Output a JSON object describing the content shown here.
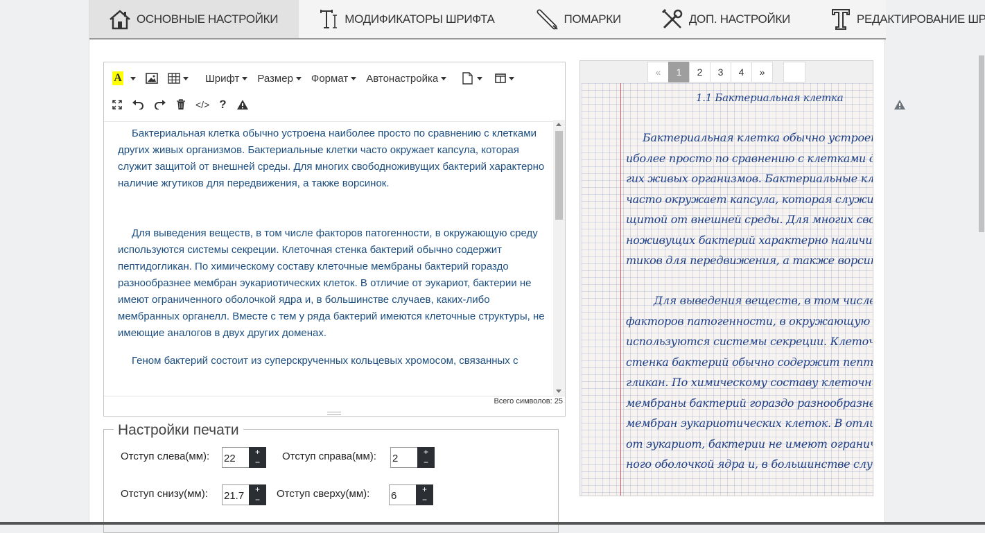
{
  "tabs": [
    {
      "label": "ОСНОВНЫЕ НАСТРОЙКИ",
      "icon": "house-icon",
      "active": true
    },
    {
      "label": "МОДИФИКАТОРЫ ШРИФТА",
      "icon": "text-cursor-icon"
    },
    {
      "label": "ПОМАРКИ",
      "icon": "pen-icon"
    },
    {
      "label": "ДОП. НАСТРОЙКИ",
      "icon": "tools-icon"
    },
    {
      "label": "РЕДАКТИРОВАНИЕ ШРИФТОВ",
      "icon": "font-t-icon"
    }
  ],
  "toolbar": {
    "font_label": "Шрифт",
    "size_label": "Размер",
    "format_label": "Формат",
    "autoset_label": "Автонастройка",
    "code_label": "</>",
    "help_label": "?"
  },
  "editor": {
    "paragraphs": [
      "Бактериальная клетка обычно устроена наиболее просто по сравнению с клетками других живых организмов. Бактериальные клетки часто окружает капсула, которая служит защитой от внешней среды. Для многих свободноживущих бактерий характерно наличие жгутиков для передвижения, а также ворсинок.",
      "Для выведения веществ, в том числе факторов патогенности, в окружающую среду используются системы секреции. Клеточная стенка бактерий обычно содержит пептидогликан. По химическому составу клеточные мембраны бактерий гораздо разнообразнее мембран эукариотических клеток. В отличие от эукариот, бактерии не имеют ограниченного оболочкой ядра и, в большинстве случаев, каких-либо мембранных органелл. Вместе с тем у ряда бактерий имеются клеточные структуры, не имеющие аналогов в двух других доменах.",
      "Геном бактерий состоит из суперскрученных кольцевых хромосом, связанных с"
    ],
    "char_count": "Всего символов: 25"
  },
  "print_settings": {
    "title": "Настройки печати",
    "left_label": "Отступ слева(мм):",
    "left_value": "22",
    "right_label": "Отступ справа(мм):",
    "right_value": "2",
    "bottom_label": "Отступ снизу(мм):",
    "bottom_value": "21.7",
    "top_label": "Отступ сверху(мм):",
    "top_value": "6",
    "plus": "+",
    "minus": "−"
  },
  "preview": {
    "pagination": {
      "prev": "«",
      "pages": [
        "1",
        "2",
        "3",
        "4"
      ],
      "next": "»",
      "current": "1"
    },
    "handwriting": [
      "1.1  Бактериальная  клетка",
      "Бактериальная клетка обычно устроена на-",
      "иболее просто по сравнению с клетками дру",
      "гих живых организмов. Бактериальные клетки",
      "часто окружает капсула, которая служит за-",
      "щитой от внешней среды. Для многих свобод",
      "ноживущих бактерий характерно наличие жгу",
      "тиков для передвижения, а также ворсинок.",
      "Для выведения  веществ, в том числе",
      "факторов патогенности, в окружающую среду",
      "используются системы секреции. Клеточная",
      "стенка бактерий обычно содержит пептидо-",
      "гликан. По химическому составу клеточные",
      "мембраны бактерий гораздо разнообразнее",
      "мембран эукариотических клеток. В отличие",
      "от эукариот, бактерии не имеют ограничен-",
      "ного оболочкой ядра и, в большинстве случаев"
    ]
  }
}
